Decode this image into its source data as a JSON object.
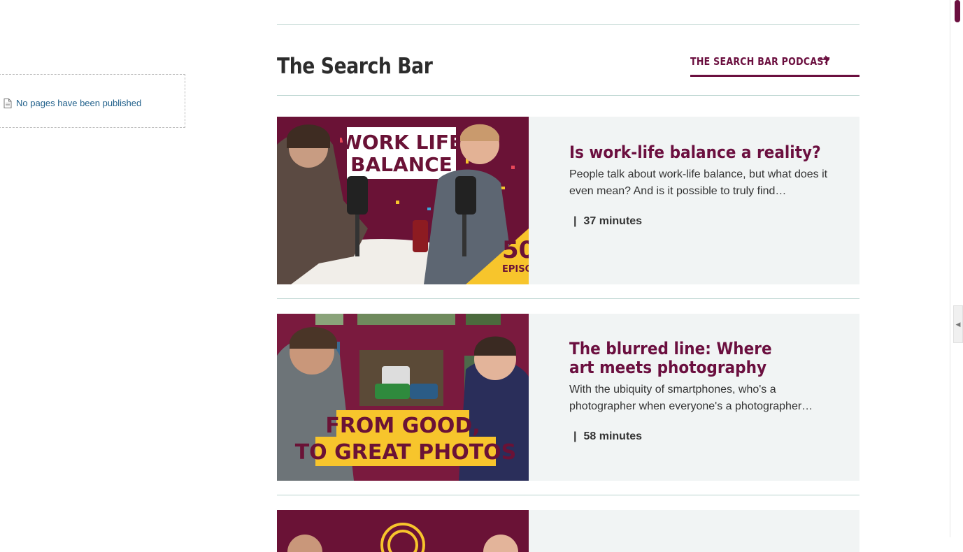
{
  "sidebar": {
    "empty_message": "No pages have been published"
  },
  "section": {
    "title": "The Search Bar",
    "podcast_link_label": "THE SEARCH BAR PODCAST",
    "arrow_icon": "arrow-right-icon"
  },
  "episodes": [
    {
      "title": "Is work-life balance a reality?",
      "description": "People talk about work-life balance, but what does it even mean? And is it possible to truly find…",
      "duration": "37 minutes",
      "thumbnail_text": [
        "WORK LIFE",
        "BALANCE"
      ],
      "badge_text": [
        "50",
        "EPISO"
      ]
    },
    {
      "title": "The blurred line: Where art meets photography",
      "description": "With the ubiquity of smartphones, who's a photographer when everyone's a photographer…",
      "duration": "58 minutes",
      "thumbnail_text": [
        "FROM GOOD,",
        "TO GREAT PHOTOS"
      ]
    },
    {
      "title": "",
      "description": "",
      "duration": ""
    }
  ],
  "colors": {
    "brand": "#6b0f3f",
    "card_bg": "#f1f4f4",
    "rule": "#b9d3ce",
    "accent_yellow": "#f7c52c"
  }
}
